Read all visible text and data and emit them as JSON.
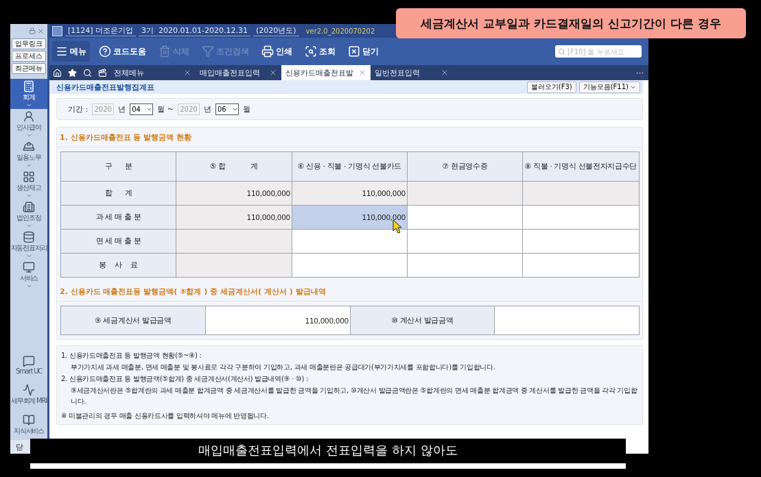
{
  "callout": {
    "text": "세금계산서 교부일과 카드결재일의 신고기간이 **다른** 경우"
  },
  "title_bar": {
    "company": "[1124] 더조은기업",
    "period": "3기  2020.01.01-2020.12.31",
    "year": "(2020년도)",
    "version": "ver2.0_2020070202"
  },
  "sidebar": {
    "quick_buttons": [
      "업무링크",
      "프로세스",
      "최근메뉴"
    ],
    "modules": [
      {
        "label": "회계",
        "selected": true
      },
      {
        "label": "인사급여",
        "selected": false
      },
      {
        "label": "일용노무",
        "selected": false
      },
      {
        "label": "생산재고",
        "selected": false
      },
      {
        "label": "법인조정",
        "selected": false
      },
      {
        "label": "자동전표처리",
        "selected": false
      },
      {
        "label": "서비스",
        "selected": false
      }
    ],
    "bottom_items": [
      "Smart UC",
      "세무회계 MRI",
      "지식서비스"
    ],
    "close_label": "닫"
  },
  "toolbar": {
    "items": [
      {
        "label": "메뉴",
        "disabled": false
      },
      {
        "label": "코드도움",
        "disabled": false
      },
      {
        "label": "삭제",
        "disabled": true
      },
      {
        "label": "조건검색",
        "disabled": true
      },
      {
        "label": "인쇄",
        "disabled": false
      },
      {
        "label": "조회",
        "disabled": false
      },
      {
        "label": "닫기",
        "disabled": false
      }
    ],
    "search_placeholder": "[F10] 을 누르세요"
  },
  "tabs": [
    {
      "label": "전체메뉴",
      "selected": false
    },
    {
      "label": "매입매출전표입력",
      "selected": false
    },
    {
      "label": "신용카드매출전표발",
      "selected": true
    },
    {
      "label": "일반전표입력",
      "selected": false
    }
  ],
  "page": {
    "title": "신용카드매출전표발행집계표",
    "buttons": [
      "불러오기(F3)",
      "기능모음(F11)"
    ],
    "period": {
      "label": "기간 :",
      "from_year": "2020",
      "from_month": "04",
      "to_year": "2020",
      "to_month": "06",
      "from_year_unit": "년",
      "to_year_unit": "년",
      "month_unit": "월",
      "separator": "월 ~"
    },
    "section1": {
      "title": "1. 신용카드매출전표 등 발행금액 현황",
      "columns": [
        "구      분",
        "⑤ 합            계",
        "⑥ 신용 · 직불 · 기명식 선불카드",
        "⑦ 현금영수증",
        "⑧ 직불 · 기명식 선불전자지급수단"
      ],
      "rows": [
        {
          "label": "합      계",
          "cells": [
            {
              "value": "110,000,000",
              "readonly": true,
              "selected": false
            },
            {
              "value": "110,000,000",
              "readonly": true,
              "selected": false
            },
            {
              "readonly": true,
              "selected": false
            },
            {
              "readonly": true,
              "selected": false
            }
          ]
        },
        {
          "label": "과 세 매 출 분",
          "cells": [
            {
              "value": "110,000,000",
              "readonly": true,
              "selected": false
            },
            {
              "value": "110,000,000",
              "readonly": false,
              "selected": true
            },
            {
              "readonly": false,
              "selected": false
            },
            {
              "readonly": false,
              "selected": false
            }
          ]
        },
        {
          "label": "면 세 매 출 분",
          "cells": [
            {
              "readonly": true,
              "selected": false
            },
            {
              "readonly": false,
              "selected": false
            },
            {
              "readonly": false,
              "selected": false
            },
            {
              "readonly": false,
              "selected": false
            }
          ]
        },
        {
          "label": "봉    사    료",
          "cells": [
            {
              "readonly": true,
              "selected": false
            },
            {
              "readonly": false,
              "selected": false
            },
            {
              "readonly": false,
              "selected": false
            },
            {
              "readonly": false,
              "selected": false
            }
          ]
        }
      ]
    },
    "section2": {
      "title": "2. 신용카드 매출전표등 발행금액( ⑤합계 ) 중 세금계산서( 계산서 ) 발급내역",
      "items": [
        {
          "label": "⑨ 세금계산서 발급금액",
          "value": "110,000,000"
        },
        {
          "label": "⑩ 계산서 발급금액"
        }
      ]
    },
    "notes": [
      {
        "kind": "heading",
        "text": "1. 신용카드매출전표 등 발행금액 현황(⑤~⑧) :"
      },
      {
        "kind": "body",
        "text": "부가가치세 과세 매출분, 면세 매출분 및 봉사료로 각각 구분하여 기입하고, 과세 매출분란은 공급대가(부가가치세를 포함합니다)를 기입합니다."
      },
      {
        "kind": "heading",
        "text": "2. 신용카드매출전표 등 발행금액(⑤합계) 중 세금계산서(계산서) 발급내역(⑨ · ⑩) :"
      },
      {
        "kind": "body",
        "text": "⑨세금계산서란은 ⑤합계란의 과세 매출분 합계금액 중 세금계산서를 발급한 금액을 기입하고, ⑩계산서 발급금액란은 ⑤합계란의 면세 매출분 합계금액 중 계산서를 발급한 금액을 각각 기입합니다."
      },
      {
        "kind": "remark",
        "text": "※ 미불관리의 경우 매출 신용카드사를 입력하셔야 메뉴에 반영됩니다."
      }
    ]
  },
  "subtitle": {
    "text": "매입매출전표입력에서 전표입력을 하지 않아도"
  }
}
